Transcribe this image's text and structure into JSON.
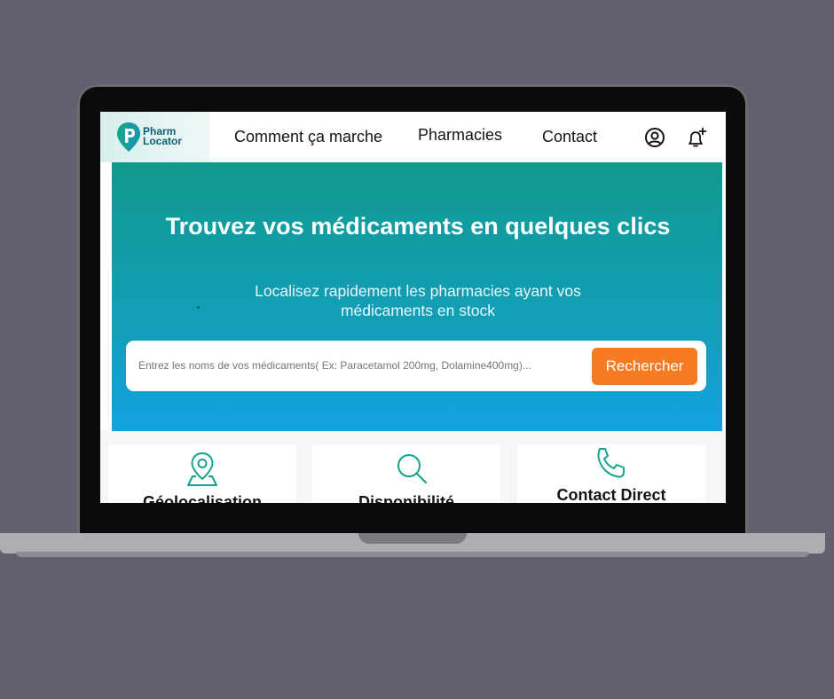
{
  "logo": {
    "line1": "Pharm",
    "line2": "Locator"
  },
  "nav": {
    "links": [
      "Comment ça marche",
      "Pharmacies",
      "Contact"
    ],
    "icons": [
      "user-circle-icon",
      "bell-plus-icon"
    ]
  },
  "hero": {
    "title": "Trouvez vos médicaments en quelques clics",
    "subtitle": "Localisez rapidement les pharmacies ayant vos médicaments en stock"
  },
  "search": {
    "placeholder": "Entrez les noms de vos médicaments( Ex: Paracetamol 200mg, Dolamine400mg)...",
    "button_label": "Rechercher"
  },
  "features": [
    {
      "title": "Géolocalisation",
      "icon": "map-pin-icon"
    },
    {
      "title": "Disponibilité",
      "icon": "search-icon"
    },
    {
      "title": "Contact Direct",
      "icon": "phone-icon"
    }
  ],
  "colors": {
    "accent_teal": "#119a8e",
    "accent_blue": "#12a2e2",
    "button_orange": "#f77b22",
    "icon_teal": "#14a38f"
  }
}
